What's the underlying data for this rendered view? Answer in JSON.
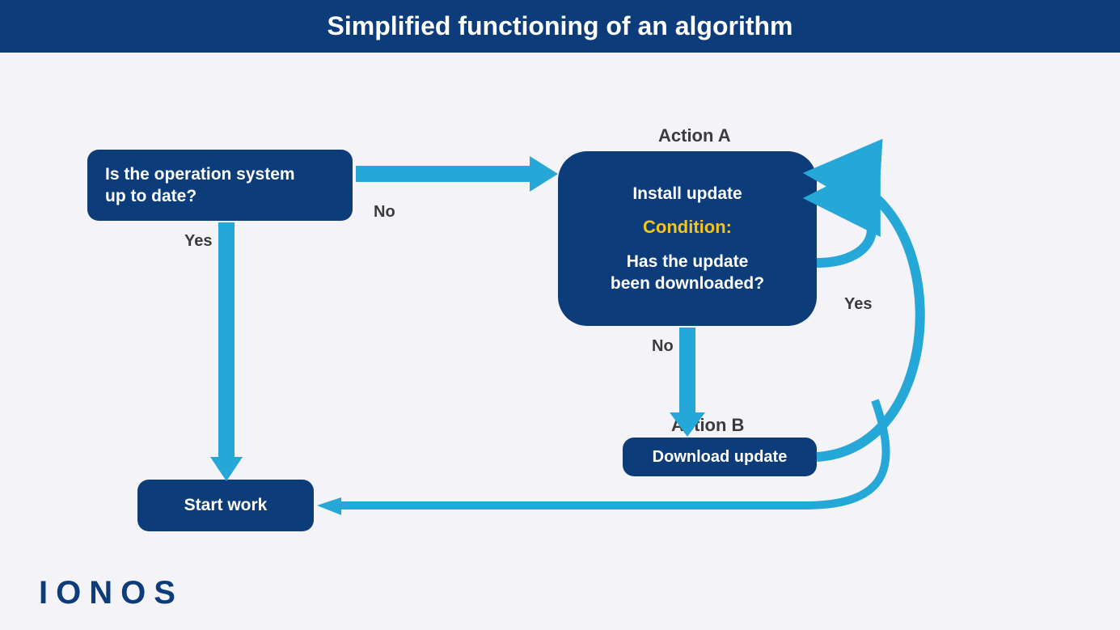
{
  "header": {
    "title": "Simplified functioning of an algorithm"
  },
  "nodes": {
    "q1": {
      "line1": "Is the operation system",
      "line2": "up to date?"
    },
    "actionA_label": "Action A",
    "actionA": {
      "line1": "Install update",
      "cond": "Condition:",
      "line2": "Has the update",
      "line3": "been downloaded?"
    },
    "actionB_label": "Action B",
    "actionB": {
      "text": "Download update"
    },
    "start": {
      "text": "Start work"
    }
  },
  "edges": {
    "q1_yes": "Yes",
    "q1_no": "No",
    "a_no": "No",
    "a_yes": "Yes"
  },
  "brand": "IONOS",
  "colors": {
    "dark": "#0d3c7a",
    "light": "#25a7d7",
    "accent": "#f5c518"
  }
}
